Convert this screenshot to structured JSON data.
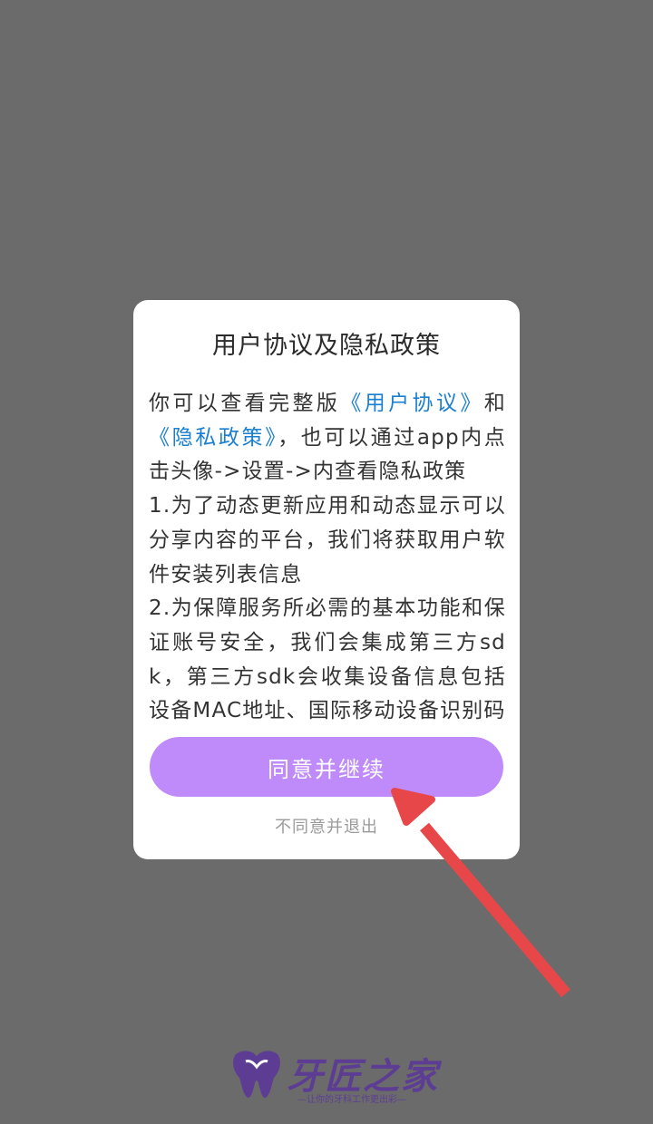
{
  "dialog": {
    "title": "用户协议及隐私政策",
    "intro_prefix": "你可以查看完整版",
    "user_agreement_link": "《用户协议》",
    "and_text": "和",
    "privacy_policy_link": "《隐私政策》",
    "intro_suffix": "，也可以通过app内点击头像->设置->内查看隐私政策",
    "item1": "1.为了动态更新应用和动态显示可以分享内容的平台，我们将获取用户软件安装列表信息",
    "item2": "2.为保障服务所必需的基本功能和保证账号安全，我们会集成第三方sdk，第三方sdk会收集设备信息包括设备MAC地址、国际移动设备识别码",
    "agree_button": "同意并继续",
    "disagree_link": "不同意并退出"
  },
  "logo": {
    "name": "牙匠之家",
    "slogan": "—让你的牙科工作更出彩—",
    "icon": "tooth-logo-icon"
  },
  "colors": {
    "overlay": "#6b6b6b",
    "accent": "#bf8bfa",
    "link": "#1a7fd0",
    "annotation_arrow": "#e8474a",
    "brand": "#5d3d93"
  }
}
